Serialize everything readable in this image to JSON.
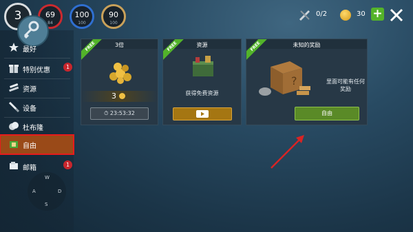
{
  "stats": {
    "level": {
      "value": "3",
      "max": ""
    },
    "health": {
      "value": "69",
      "max": "84"
    },
    "water": {
      "value": "100",
      "max": "100"
    },
    "food": {
      "value": "90",
      "max": "100"
    }
  },
  "resources": {
    "tools": "0/2",
    "coins": "30"
  },
  "sidebar": {
    "items": [
      {
        "label": "最好",
        "icon": "star-icon"
      },
      {
        "label": "特别优惠",
        "icon": "gift-box-icon",
        "badge": "1"
      },
      {
        "label": "资源",
        "icon": "resources-icon"
      },
      {
        "label": "设备",
        "icon": "equipment-icon"
      },
      {
        "label": "杜布隆",
        "icon": "doubloon-icon"
      },
      {
        "label": "自由",
        "icon": "free-icon"
      },
      {
        "label": "邮箱",
        "icon": "mailbox-icon",
        "badge": "1"
      }
    ]
  },
  "wasd": {
    "w": "W",
    "a": "A",
    "s": "S",
    "d": "D"
  },
  "cards": [
    {
      "ribbon": "FREE",
      "title": "3倍",
      "reward": "3",
      "timer": "23:53:32"
    },
    {
      "ribbon": "FREE",
      "title": "资源",
      "desc": "获得免费资源"
    },
    {
      "ribbon": "FREE",
      "title": "未知的奖励",
      "desc": "里面可能有任何奖励",
      "button": "自由"
    }
  ],
  "colors": {
    "accent_green": "#54b32a",
    "active_tab": "#9a4a18",
    "highlight_red": "#e81b1b"
  }
}
